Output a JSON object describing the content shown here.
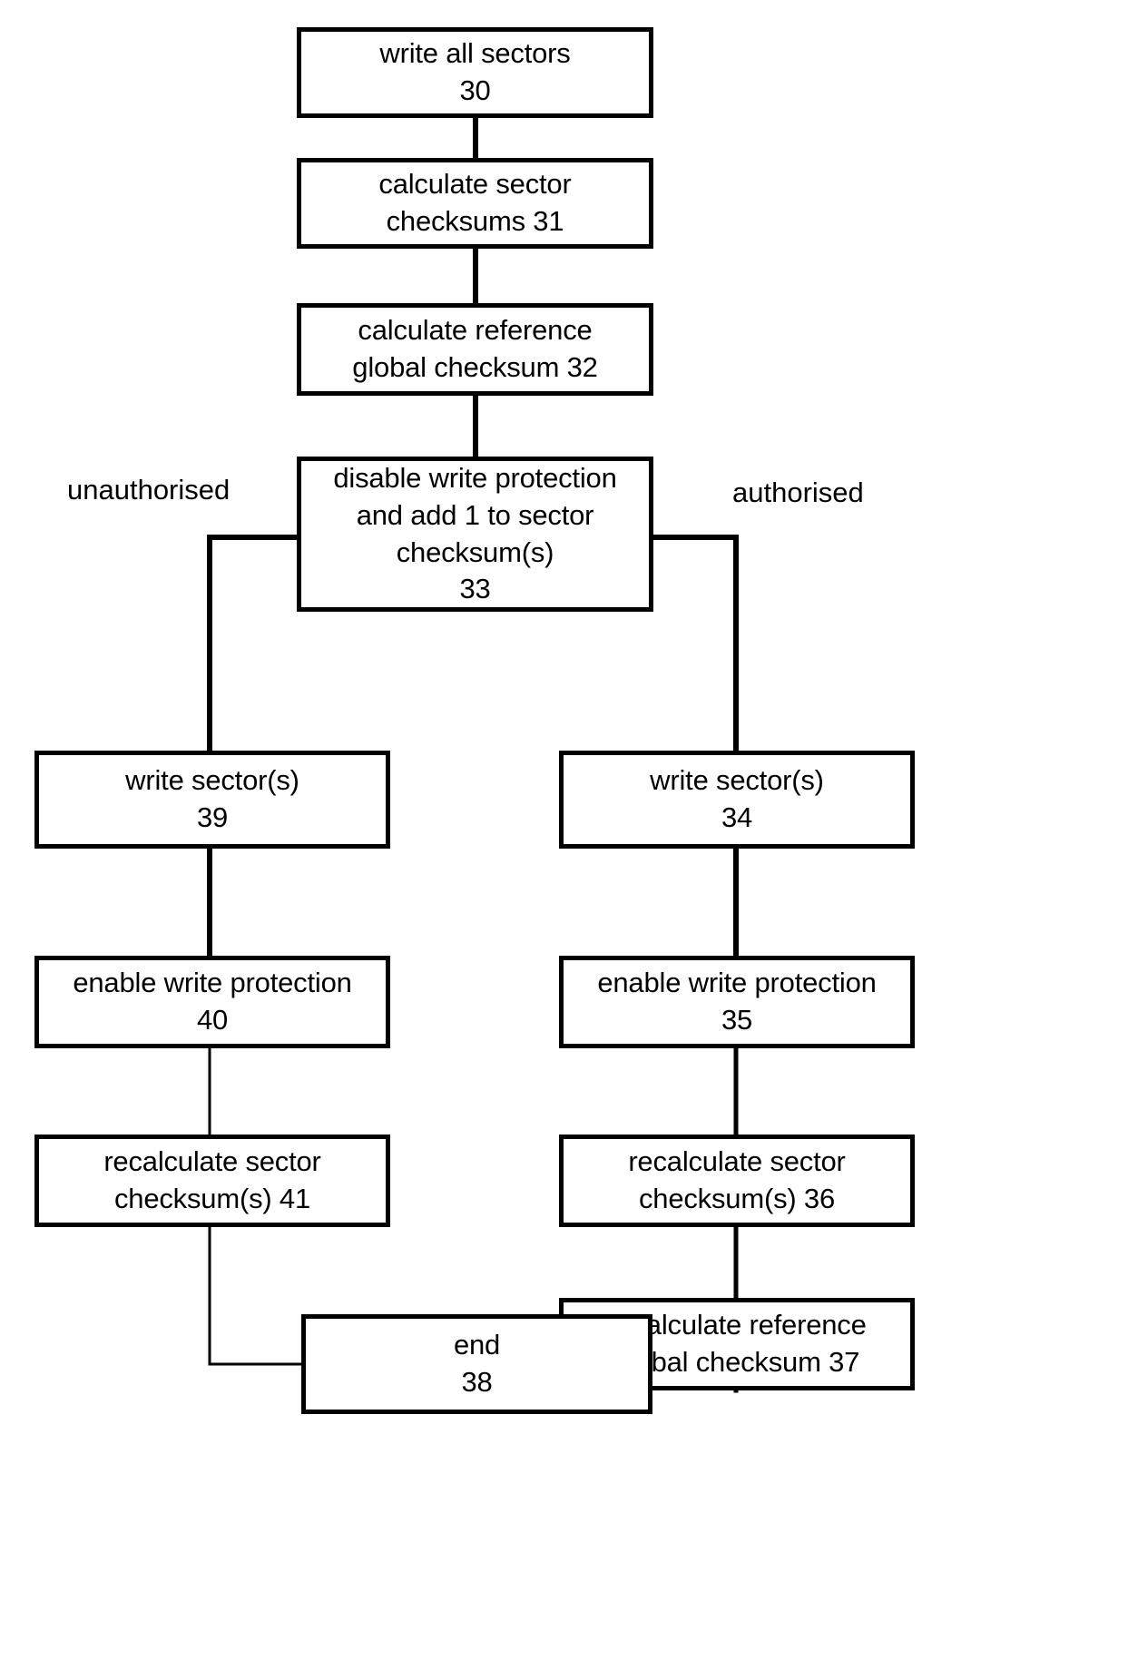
{
  "diagram": {
    "type": "flowchart",
    "title": "",
    "nodes": [
      {
        "id": "30",
        "ref": "30",
        "lines": [
          "write all sectors",
          "30"
        ]
      },
      {
        "id": "31",
        "ref": "31",
        "lines": [
          "calculate sector",
          "checksums 31"
        ]
      },
      {
        "id": "32",
        "ref": "32",
        "lines": [
          "calculate reference",
          "global checksum 32"
        ]
      },
      {
        "id": "33",
        "ref": "33",
        "lines": [
          "disable write protection",
          "and add 1 to sector",
          "checksum(s)",
          "33"
        ]
      },
      {
        "id": "39",
        "ref": "39",
        "lines": [
          "write sector(s)",
          "39"
        ]
      },
      {
        "id": "40",
        "ref": "40",
        "lines": [
          "enable write protection",
          "40"
        ]
      },
      {
        "id": "41",
        "ref": "41",
        "lines": [
          "recalculate sector",
          "checksum(s) 41"
        ]
      },
      {
        "id": "34",
        "ref": "34",
        "lines": [
          "write sector(s)",
          "34"
        ]
      },
      {
        "id": "35",
        "ref": "35",
        "lines": [
          "enable write protection",
          "35"
        ]
      },
      {
        "id": "36",
        "ref": "36",
        "lines": [
          "recalculate sector",
          "checksum(s) 36"
        ]
      },
      {
        "id": "37",
        "ref": "37",
        "lines": [
          "recalculate reference",
          "global checksum 37"
        ]
      },
      {
        "id": "38",
        "ref": "38",
        "lines": [
          "end",
          "38"
        ]
      }
    ],
    "edge_labels": [
      {
        "id": "unauthorised",
        "text": "unauthorised"
      },
      {
        "id": "authorised",
        "text": "authorised"
      }
    ],
    "colors": {
      "stroke": "#000000",
      "fill": "#ffffff",
      "text": "#000000"
    }
  }
}
